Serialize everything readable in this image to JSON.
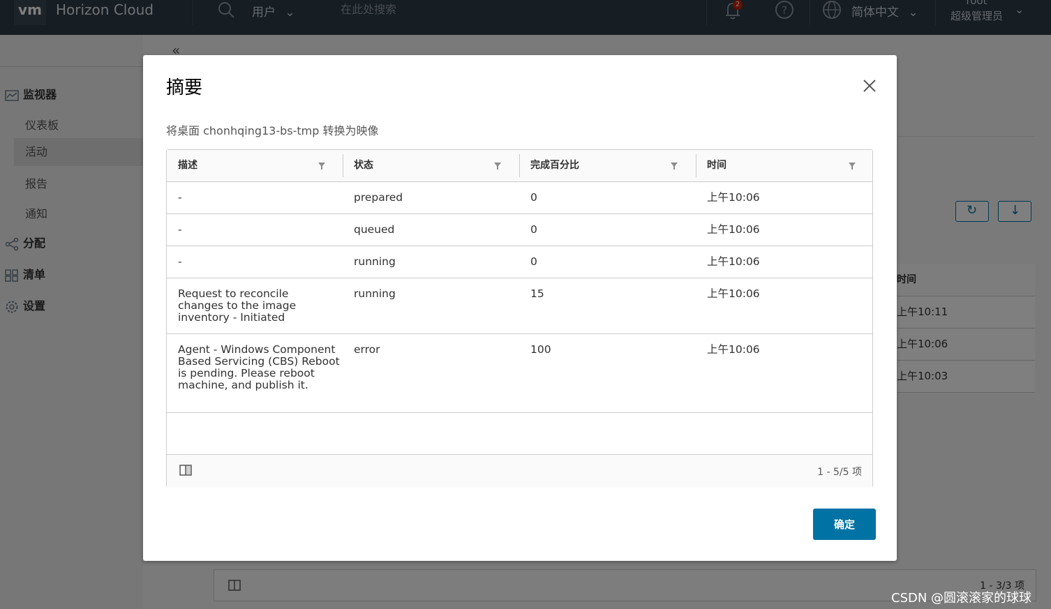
{
  "app": {
    "logo_text": "vm",
    "title": "Horizon Cloud",
    "search_scope": "用户",
    "search_placeholder": "在此处搜索",
    "notification_count": "2",
    "language": "简体中文",
    "user_name": "root",
    "user_role": "超级管理员"
  },
  "sidebar": {
    "sections": [
      {
        "label": "监视器",
        "icon": "monitor-icon"
      },
      {
        "label": "分配",
        "icon": "share-icon"
      },
      {
        "label": "清单",
        "icon": "grid-icon"
      },
      {
        "label": "设置",
        "icon": "gear-icon"
      }
    ],
    "monitor_items": [
      "仪表板",
      "活动",
      "报告",
      "通知"
    ],
    "active_item": "活动"
  },
  "background_table": {
    "header_time": "时间",
    "times": [
      "上午10:11",
      "上午10:06",
      "上午10:03"
    ],
    "footer_count": "1 - 3/3 项"
  },
  "modal": {
    "title": "摘要",
    "subtitle": "将桌面 chonhqing13-bs-tmp 转换为映像",
    "columns": [
      "描述",
      "状态",
      "完成百分比",
      "时间"
    ],
    "rows": [
      {
        "desc": "-",
        "status": "prepared",
        "percent": "0",
        "time": "上午10:06"
      },
      {
        "desc": "-",
        "status": "queued",
        "percent": "0",
        "time": "上午10:06"
      },
      {
        "desc": "-",
        "status": "running",
        "percent": "0",
        "time": "上午10:06"
      },
      {
        "desc": "Request to reconcile changes to the image inventory - Initiated",
        "status": "running",
        "percent": "15",
        "time": "上午10:06"
      },
      {
        "desc": "Agent - Windows Component Based Servicing (CBS) Reboot is pending. Please reboot machine, and publish it.",
        "status": "error",
        "percent": "100",
        "time": "上午10:06"
      }
    ],
    "footer_count": "1 - 5/5 项",
    "ok_label": "确定"
  },
  "watermark": "CSDN @圆滚滚家的球球",
  "colors": {
    "topbar": "#2d3b47",
    "primary": "#0072a3",
    "overlay": "rgba(0,0,0,0.5)"
  }
}
